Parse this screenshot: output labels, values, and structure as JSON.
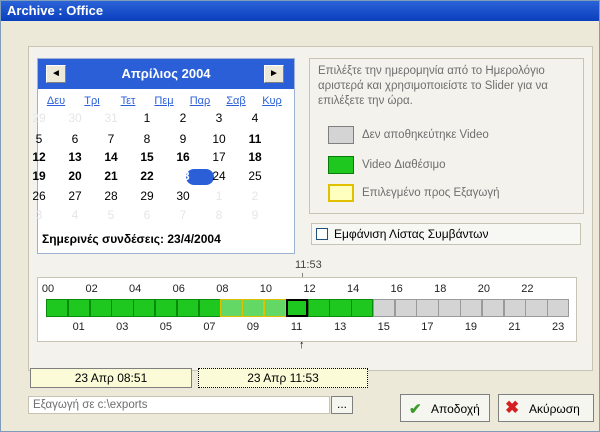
{
  "window": {
    "title": "Archive : Office"
  },
  "calendar": {
    "month_label": "Απρίλιος 2004",
    "prev_label": "◄",
    "next_label": "►",
    "weekdays": [
      "Δευ",
      "Τρι",
      "Τετ",
      "Πεμ",
      "Παρ",
      "Σαβ",
      "Κυρ"
    ],
    "weeks": [
      [
        "29",
        "30",
        "31",
        "1",
        "2",
        "3",
        "4"
      ],
      [
        "5",
        "6",
        "7",
        "8",
        "9",
        "10",
        "11"
      ],
      [
        "12",
        "13",
        "14",
        "15",
        "16",
        "17",
        "18"
      ],
      [
        "19",
        "20",
        "21",
        "22",
        "23",
        "24",
        "25"
      ],
      [
        "26",
        "27",
        "28",
        "29",
        "30",
        "1",
        "2"
      ],
      [
        "3",
        "4",
        "5",
        "6",
        "7",
        "8",
        "9"
      ]
    ],
    "selected_day": "23",
    "today_label": "Σημερινές συνδέσεις: 23/4/2004"
  },
  "info": {
    "instructions": "Επιλέξτε την ημερομηνία από το Ημερολόγιο αριστερά και χρησιμοποιείστε το Slider για να επιλέξετε την ώρα.",
    "legend": [
      {
        "label": "Δεν αποθηκεύτηκε Video",
        "color": "#d4d4d4"
      },
      {
        "label": "Video Διαθέσιμο",
        "color": "#1ec81e"
      },
      {
        "label": "Επιλεγμένο προς Εξαγωγή",
        "color": "#ffffc0"
      }
    ],
    "event_list_label": "Εμφάνιση Λίστας Συμβάντων"
  },
  "timeline": {
    "cursor_time": "11:53",
    "top_ticks": [
      "00",
      "02",
      "04",
      "06",
      "08",
      "10",
      "12",
      "14",
      "16",
      "18",
      "20",
      "22"
    ],
    "bottom_ticks": [
      "01",
      "03",
      "05",
      "07",
      "09",
      "11",
      "13",
      "15",
      "17",
      "19",
      "21",
      "23"
    ]
  },
  "selection": {
    "start": "23 Απρ  08:51",
    "end": "23 Απρ  11:53"
  },
  "export": {
    "path": "Εξαγωγή σε c:\\exports",
    "browse_label": "..."
  },
  "buttons": {
    "ok_label": "Αποδοχή",
    "cancel_label": "Ακύρωση"
  },
  "colors": {
    "accent": "#2a5fd8",
    "available": "#1ec81e",
    "selected_export": "#ffffc0",
    "no_video": "#d4d4d4"
  }
}
